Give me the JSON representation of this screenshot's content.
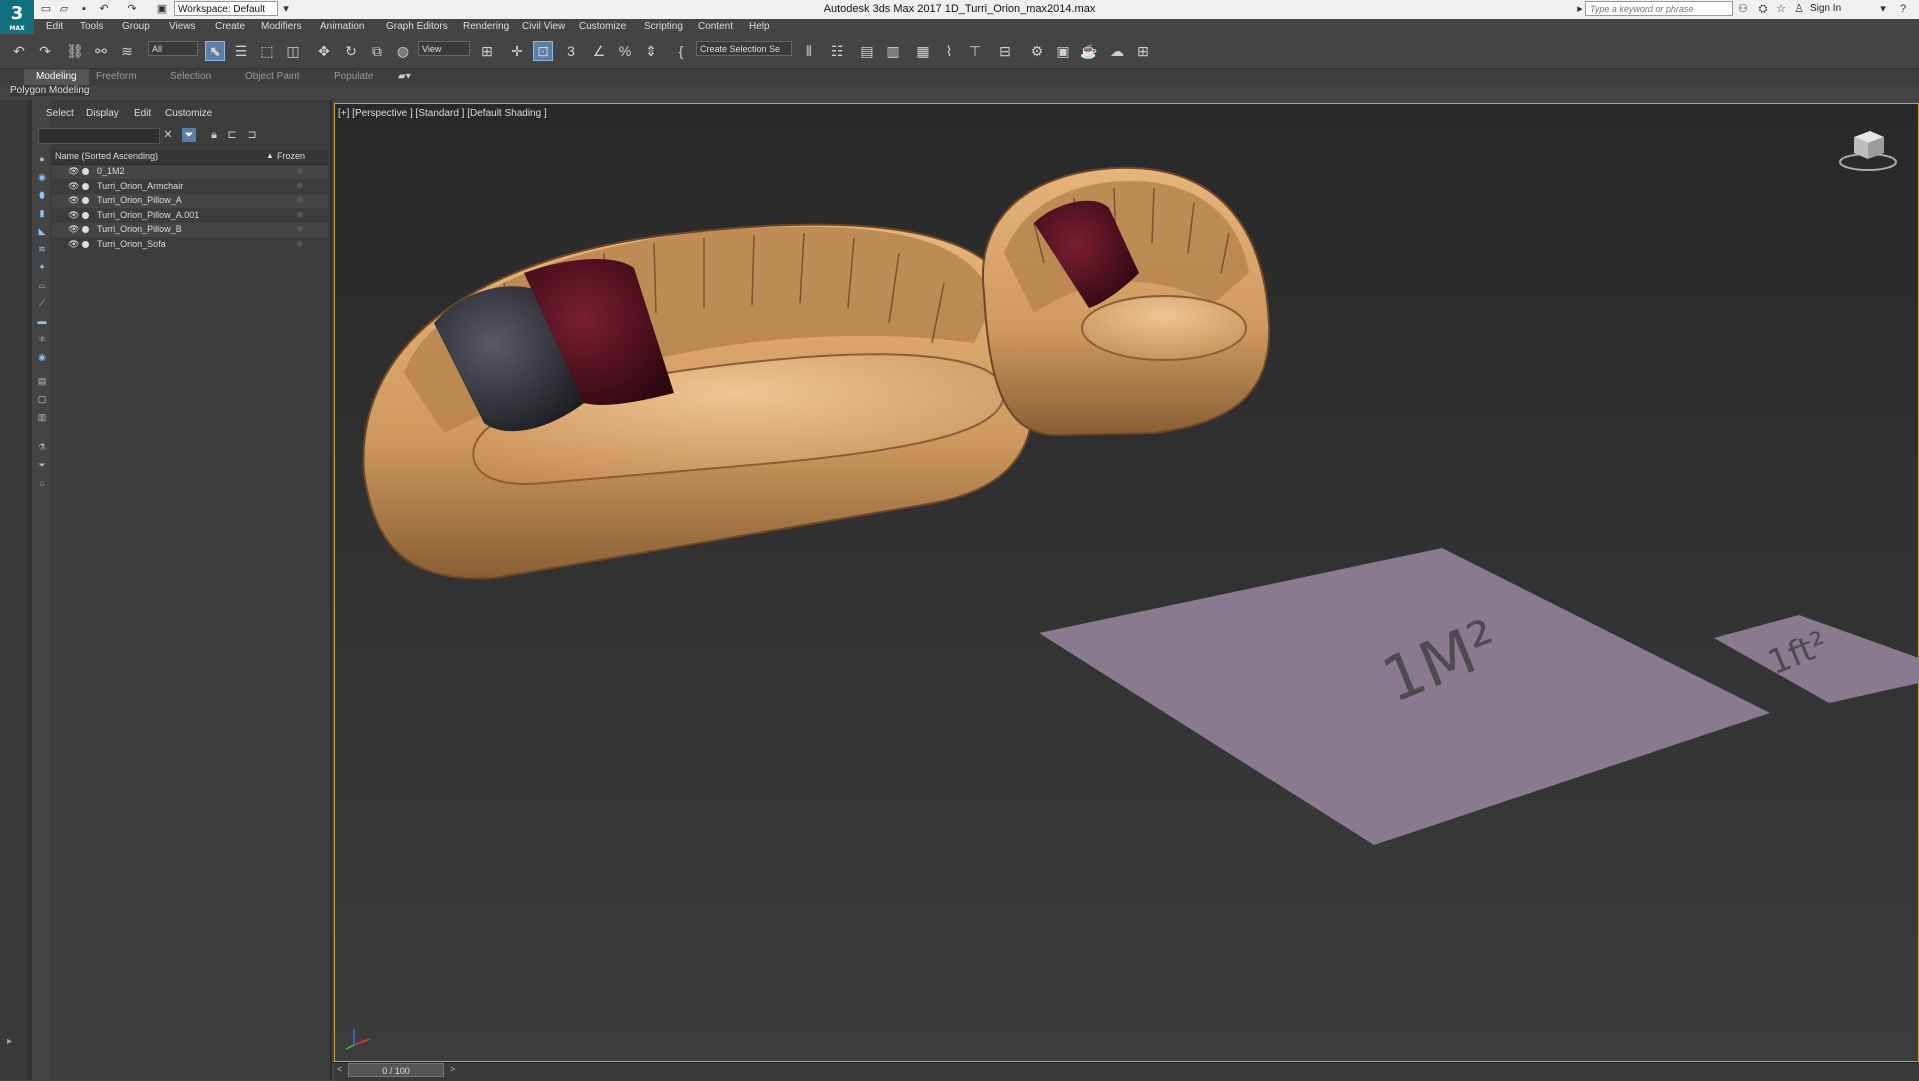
{
  "app": {
    "window_title": "Autodesk 3ds Max 2017     1D_Turri_Orion_max2014.max",
    "logo_text": "3",
    "logo_sub": "MAX",
    "workspace_label": "Workspace: Default",
    "search_placeholder": "Type a keyword or phrase",
    "sign_in": "Sign In"
  },
  "menu": [
    "Edit",
    "Tools",
    "Group",
    "Views",
    "Create",
    "Modifiers",
    "Animation",
    "Graph Editors",
    "Rendering",
    "Civil View",
    "Customize",
    "Scripting",
    "Content",
    "Help"
  ],
  "toolbar": {
    "filter_value": "All",
    "ref_coord_value": "View",
    "selection_set_value": "Create Selection Se"
  },
  "ribbon": {
    "tabs": [
      "Modeling",
      "Freeform",
      "Selection",
      "Object Paint",
      "Populate"
    ],
    "active_tab": "Modeling",
    "panel_label": "Polygon Modeling"
  },
  "scene_explorer": {
    "menus": [
      "Select",
      "Display",
      "Edit",
      "Customize"
    ],
    "col_name": "Name (Sorted Ascending)",
    "col_sort_marker": "▲",
    "col_frozen": "Frozen",
    "rows": [
      {
        "name": "0_1M2"
      },
      {
        "name": "Turri_Orion_Armchair"
      },
      {
        "name": "Turri_Orion_Pillow_A"
      },
      {
        "name": "Turri_Orion_Pillow_A.001"
      },
      {
        "name": "Turri_Orion_Pillow_B"
      },
      {
        "name": "Turri_Orion_Sofa"
      }
    ]
  },
  "viewport": {
    "label": "[+] [Perspective ] [Standard ] [Default Shading ]",
    "plane_large_label": "1M²",
    "plane_small_label": "1ft²"
  },
  "timeline": {
    "frame": "0 / 100",
    "prev": "<",
    "next": ">"
  },
  "colors": {
    "sofa": "#d9a36a",
    "pillow_dark": "#3a3a44",
    "pillow_red": "#5a1322",
    "plane": "#8a7a90",
    "viewport_border": "#c6a44a",
    "accent": "#5b7ea8"
  }
}
